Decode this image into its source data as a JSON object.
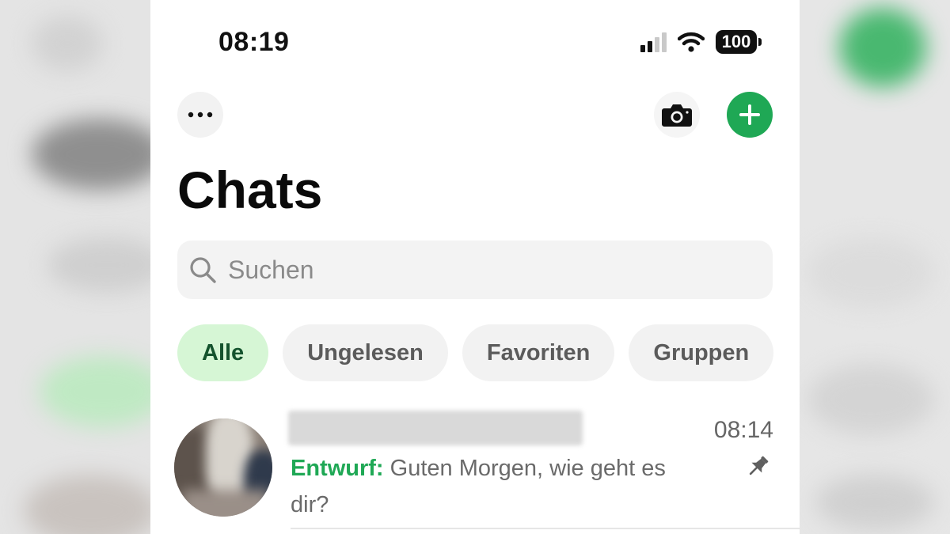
{
  "status_bar": {
    "time": "08:19",
    "battery": "100"
  },
  "header": {
    "more_icon": "ellipsis-icon",
    "camera_icon": "camera-icon",
    "new_chat_icon": "plus-icon",
    "title": "Chats"
  },
  "search": {
    "placeholder": "Suchen",
    "value": ""
  },
  "filters": [
    {
      "label": "Alle",
      "active": true
    },
    {
      "label": "Ungelesen",
      "active": false
    },
    {
      "label": "Favoriten",
      "active": false
    },
    {
      "label": "Gruppen",
      "active": false
    }
  ],
  "chats": [
    {
      "time": "08:14",
      "draft_label": "Entwurf:",
      "preview": "Guten Morgen, wie geht es dir?",
      "pinned": true
    }
  ],
  "colors": {
    "accent": "#1fa855",
    "active_chip_bg": "#d6f6d5",
    "active_chip_text": "#14532d"
  }
}
